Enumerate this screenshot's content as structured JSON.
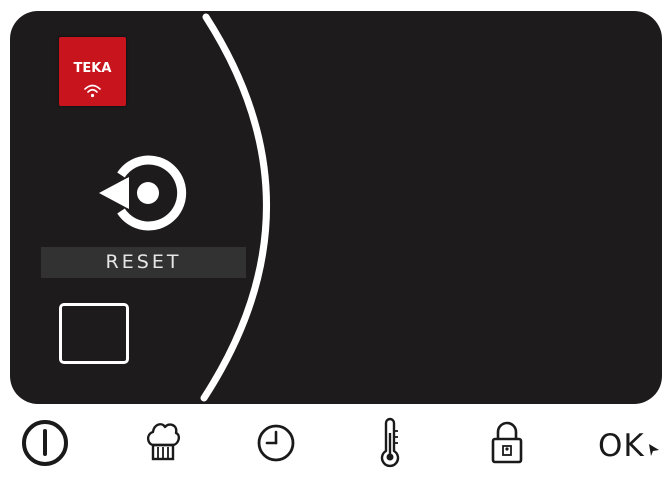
{
  "brand": {
    "name": "TEKA",
    "icon": "wifi-icon",
    "color": "#c8151d"
  },
  "screen": {
    "background": "#1e1b1c",
    "reset_label": "RESET",
    "reset_icon": "reset-rotate-icon",
    "square_button_icon": "square-outline-icon"
  },
  "bottom_bar": {
    "items": [
      {
        "icon": "power-icon"
      },
      {
        "icon": "chef-hat-icon"
      },
      {
        "icon": "clock-icon"
      },
      {
        "icon": "thermometer-icon"
      },
      {
        "icon": "lock-icon"
      }
    ],
    "ok_label": "OK",
    "ok_icon": "pointer-cursor-icon"
  }
}
